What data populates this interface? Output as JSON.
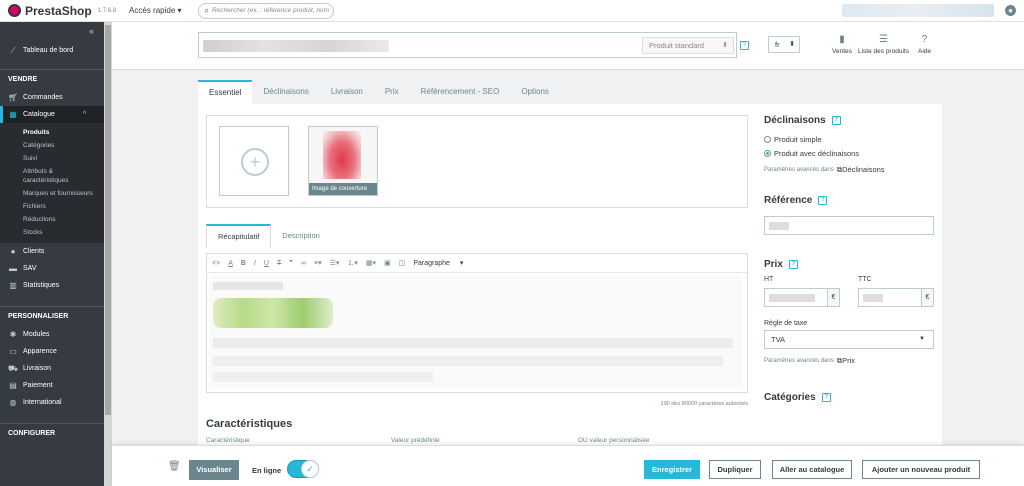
{
  "topbar": {
    "logo": "PrestaShop",
    "version": "1.7.6.8",
    "quick_access": "Accès rapide",
    "search_placeholder": "Rechercher (ex. : référence produit, nom"
  },
  "sidebar": {
    "dashboard": "Tableau de bord",
    "sections": {
      "sell": "VENDRE",
      "customize": "PERSONNALISER",
      "configure": "CONFIGURER"
    },
    "sell_items": {
      "orders": "Commandes",
      "catalog": "Catalogue",
      "clients": "Clients",
      "sav": "SAV",
      "stats": "Statistiques"
    },
    "catalog_sub": [
      "Produits",
      "Catégories",
      "Suivi",
      "Attributs & caractéristiques",
      "Marques et fournisseurs",
      "Fichiers",
      "Réductions",
      "Stocks"
    ],
    "customize_items": {
      "modules": "Modules",
      "appearance": "Apparence",
      "shipping": "Livraison",
      "payment": "Paiement",
      "international": "International"
    }
  },
  "header": {
    "product_type": "Produit standard",
    "lang": "fr",
    "sales": "Ventes",
    "product_list": "Liste des produits",
    "help": "Aide"
  },
  "tabs": [
    "Essentiel",
    "Déclinaisons",
    "Livraison",
    "Prix",
    "Référencement - SEO",
    "Options"
  ],
  "images": {
    "cover_label": "Image de couverture"
  },
  "editor": {
    "tabs": [
      "Récapitulatif",
      "Description"
    ],
    "format": "Paragraphe",
    "char_count": "190 des 80000 caractères autorisés"
  },
  "characteristics": {
    "title": "Caractéristiques",
    "cols": [
      "Caractéristique",
      "Valeur prédéfinie",
      "OU valeur personnalisée"
    ]
  },
  "right": {
    "variants_title": "Déclinaisons",
    "simple": "Produit simple",
    "with_variants": "Produit avec déclinaisons",
    "adv_params": "Paramètres avancés dans",
    "variants_link": "Déclinaisons",
    "reference_title": "Référence",
    "price_title": "Prix",
    "ht": "HT",
    "ttc": "TTC",
    "currency": "€",
    "tax_rule_label": "Règle de taxe",
    "tax_rule": "TVA",
    "price_link": "Prix",
    "categories_title": "Catégories"
  },
  "footer": {
    "preview": "Visualiser",
    "online": "En ligne",
    "save": "Enregistrer",
    "duplicate": "Dupliquer",
    "to_catalog": "Aller au catalogue",
    "add_new": "Ajouter un nouveau produit"
  },
  "colors": {
    "accent": "#25b9d7",
    "sidebar": "#363a41",
    "brand": "#df0067"
  }
}
